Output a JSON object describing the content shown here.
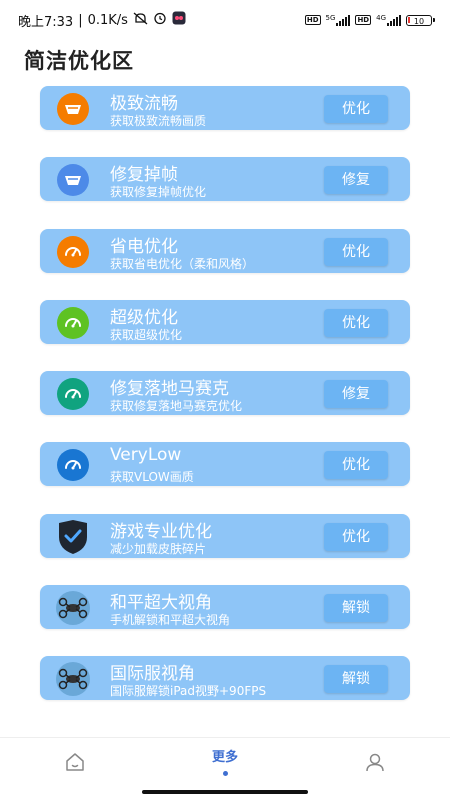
{
  "status_bar": {
    "time": "晚上7:33",
    "network_speed": "0.1K/s",
    "network_type_1": "5G",
    "network_type_2": "4G",
    "battery": "10",
    "hd_label": "HD"
  },
  "page": {
    "title": "简洁优化区"
  },
  "colors": {
    "card": "#8ec5f7",
    "button": "#6cb4f3",
    "accent": "#3f6fd1"
  },
  "items": [
    {
      "title": "极致流畅",
      "subtitle": "获取极致流畅画质",
      "button": "优化",
      "icon": "speedometer-icon",
      "icon_color": "#f57c00"
    },
    {
      "title": "修复掉帧",
      "subtitle": "获取修复掉帧优化",
      "button": "修复",
      "icon": "speedometer-icon",
      "icon_color": "#4d8ae8"
    },
    {
      "title": "省电优化",
      "subtitle": "获取省电优化（柔和风格）",
      "button": "优化",
      "icon": "gauge-icon",
      "icon_color": "#f57c00"
    },
    {
      "title": "超级优化",
      "subtitle": "获取超级优化",
      "button": "优化",
      "icon": "gauge-icon",
      "icon_color": "#5ec223"
    },
    {
      "title": "修复落地马赛克",
      "subtitle": "获取修复落地马赛克优化",
      "button": "修复",
      "icon": "gauge-icon",
      "icon_color": "#10a37f"
    },
    {
      "title": "VeryLow",
      "subtitle": "获取VLOW画质",
      "button": "优化",
      "icon": "gauge-icon",
      "icon_color": "#1976d2"
    },
    {
      "title": "游戏专业优化",
      "subtitle": "减少加载皮肤碎片",
      "button": "优化",
      "icon": "shield-check-icon",
      "icon_color": "#1f2630"
    },
    {
      "title": "和平超大视角",
      "subtitle": "手机解锁和平超大视角",
      "button": "解锁",
      "icon": "drone-icon",
      "icon_color": "#6aa8d8"
    },
    {
      "title": "国际服视角",
      "subtitle": "国际服解锁iPad视野+90FPS",
      "button": "解锁",
      "icon": "drone-icon",
      "icon_color": "#6aa8d8"
    }
  ],
  "bottom_nav": {
    "home": {
      "icon": "home-icon"
    },
    "more": {
      "label": "更多"
    },
    "profile": {
      "icon": "user-icon"
    }
  }
}
